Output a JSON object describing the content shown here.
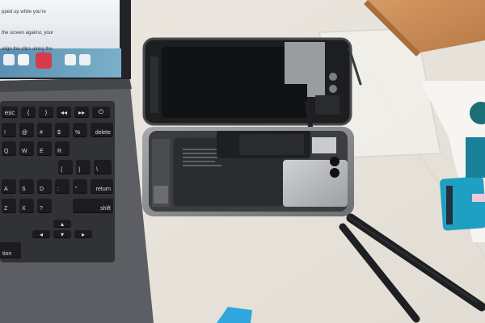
{
  "photo": {
    "subject": "",
    "colors": {
      "tablecloth": "#ebe6de",
      "laptop_body": "#5a5c61",
      "keycap": "#1c1c1e",
      "phone_frame": "#8d8f93",
      "battery": "#2b2c2e",
      "box": "#c98a56",
      "spudger": "#1e1f22",
      "cyan_part": "#1f9fc2"
    }
  },
  "laptop_screen": {
    "lines": [
      "pped up while you're",
      "the screen against, your",
      "align the clips along the"
    ]
  },
  "keyboard": {
    "keys": [
      "esc",
      "⟨",
      "⟩",
      "◂◂",
      "▸▸",
      "⏻",
      "!",
      "@",
      "#",
      "$",
      "%",
      "delete",
      "Q",
      "W",
      "E",
      "R",
      "{",
      "}",
      "\\",
      "A",
      "S",
      "D",
      ":",
      "\"",
      "return",
      "Z",
      "X",
      "?",
      "shift",
      "▴",
      "◂",
      "▾",
      "▸",
      "tion"
    ]
  }
}
